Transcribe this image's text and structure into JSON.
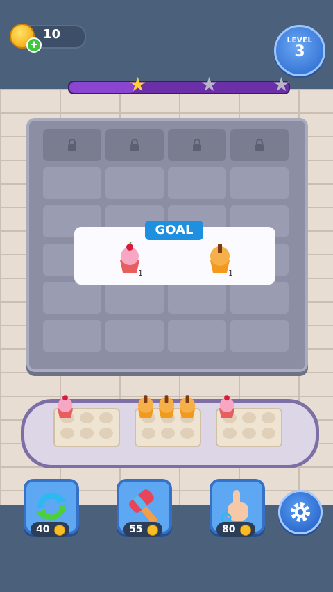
{
  "hud": {
    "coins": "10",
    "level_label": "LEVEL",
    "level_number": "3"
  },
  "progress": {
    "value": 0.3,
    "stars": [
      {
        "name": "star-1",
        "filled": true
      },
      {
        "name": "star-2",
        "filled": false
      },
      {
        "name": "star-3",
        "filled": false
      }
    ]
  },
  "goal": {
    "label": "GOAL",
    "items": [
      {
        "icon": "pink-cupcake-icon",
        "count": "1"
      },
      {
        "icon": "orange-cupcake-icon",
        "count": "1"
      }
    ]
  },
  "board": {
    "columns": 4,
    "rows": 6,
    "locked_row": 1
  },
  "trays": [
    {
      "name": "tray-1",
      "cupcakes": [
        "pink"
      ]
    },
    {
      "name": "tray-2",
      "cupcakes": [
        "orange",
        "orange",
        "orange"
      ]
    },
    {
      "name": "tray-3",
      "cupcakes": [
        "pink"
      ]
    }
  ],
  "tools": [
    {
      "name": "shuffle-tool",
      "icon": "shuffle-icon",
      "price": "40"
    },
    {
      "name": "hammer-tool",
      "icon": "hammer-icon",
      "price": "55"
    },
    {
      "name": "hand-tool",
      "icon": "hand-icon",
      "price": "80"
    }
  ],
  "colors": {
    "progress_fill": "#6b2fa8",
    "star_filled": "#ffd23a",
    "star_empty": "#b8b8c4",
    "goal_tag": "#1f8fe0"
  }
}
